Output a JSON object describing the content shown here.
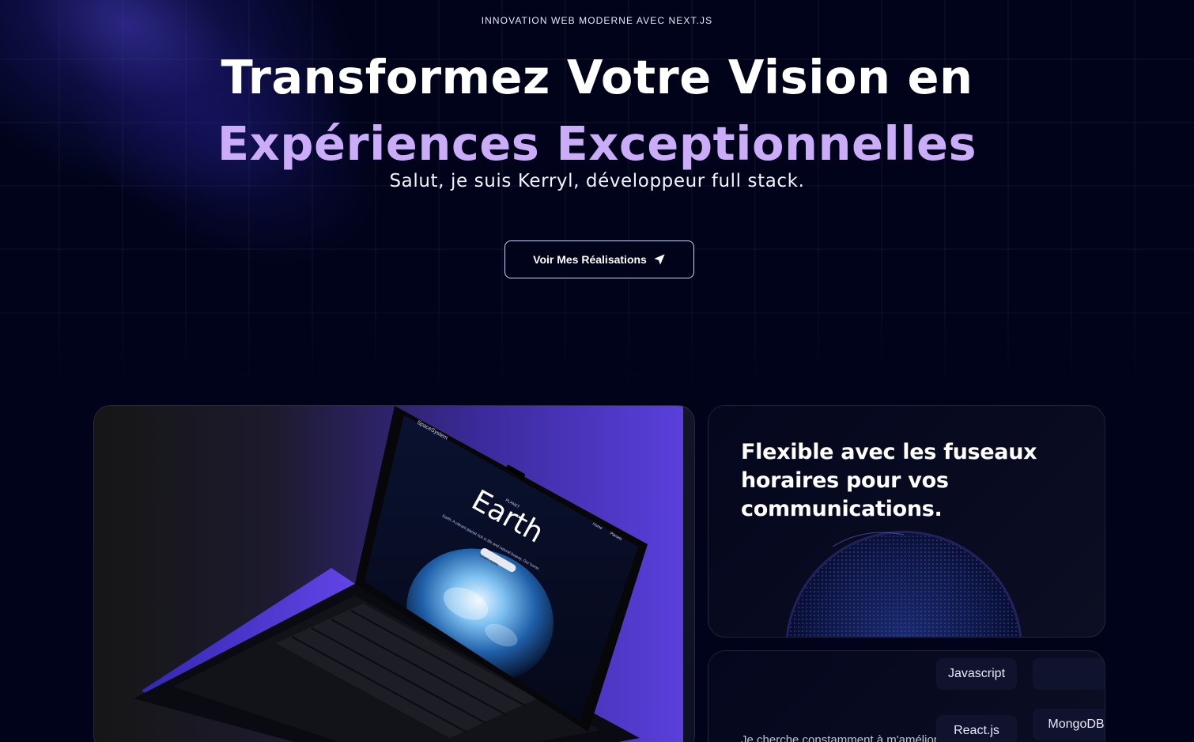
{
  "hero": {
    "eyebrow": "INNOVATION WEB MODERNE AVEC NEXT.JS",
    "headline_line1": "Transformez Votre Vision en",
    "headline_line2": "Expériences Exceptionnelles",
    "subtitle": "Salut, je suis Kerryl, développeur full stack.",
    "cta_label": "Voir Mes Réalisations",
    "cta_icon": "send-icon"
  },
  "laptop_screen": {
    "brand": "SpaceSystem",
    "kicker": "PLANET",
    "title": "Earth",
    "tagline": "Earth: A vibrant planet rich in life and natural beauty. Our home.",
    "button": "Learn more",
    "nav_1": "Home",
    "nav_2": "Planets"
  },
  "cards": {
    "timezone_title": "Flexible avec les fuseaux horaires pour vos communications.",
    "stack_description": "Je cherche constamment à m'améliorer",
    "tags": [
      "Javascript",
      "React.js",
      "MongoDB"
    ]
  },
  "colors": {
    "background": "#000319",
    "accent_purple": "#cbacf9",
    "card_bg": "#0c0e23"
  }
}
